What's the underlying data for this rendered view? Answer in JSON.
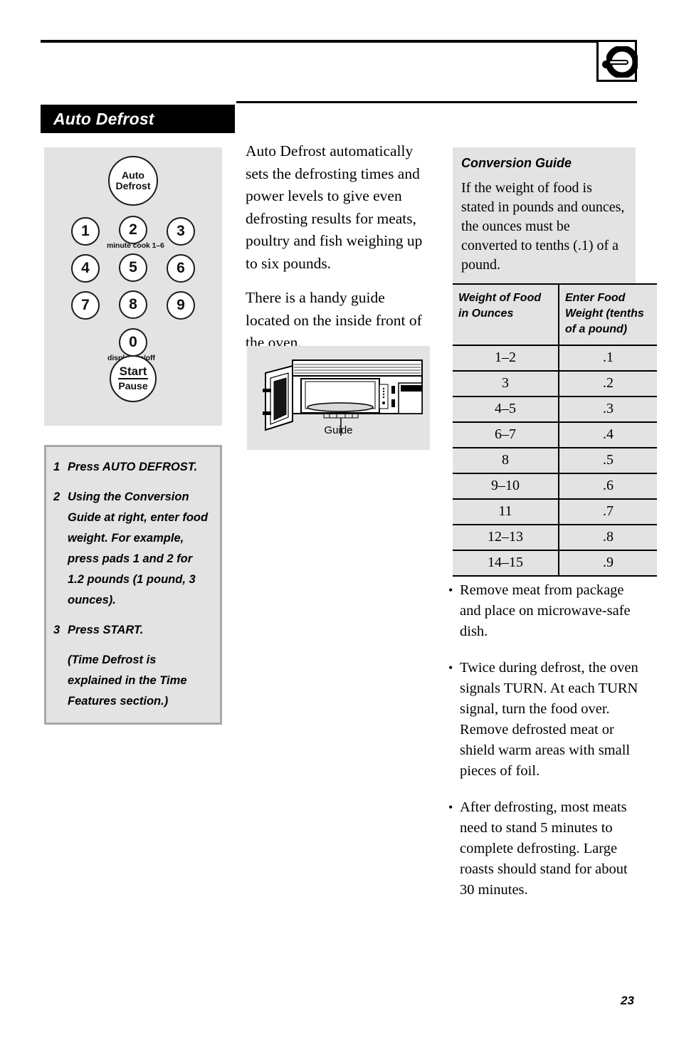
{
  "page": {
    "number": "23",
    "section_title": "Auto Defrost",
    "tab_icon": "control-knob-icon"
  },
  "keypad": {
    "auto_defrost_pad": {
      "line1": "Auto",
      "line2": "Defrost"
    },
    "number_pads": [
      "1",
      "2",
      "3",
      "4",
      "5",
      "6",
      "7",
      "8",
      "9"
    ],
    "zero_pad": "0",
    "captions": {
      "minute_cook": "minute cook 1–6",
      "display_onoff": "display on/off"
    },
    "start_pad": {
      "line1": "Start",
      "line2": "Pause"
    }
  },
  "steps": [
    {
      "num": "1",
      "text": "Press AUTO DEFROST."
    },
    {
      "num": "2",
      "text": "Using the Conversion Guide at right, enter food weight. For example, press pads 1 and 2 for 1.2 pounds (1 pound, 3 ounces)."
    },
    {
      "num": "3",
      "text": "Press START."
    }
  ],
  "steps_note": "(Time Defrost is explained in the Time Features section.)",
  "intro": {
    "paragraph1": "Auto Defrost automatically sets the defrosting times and power levels to give even defrosting results for meats, poultry and fish weighing up to six pounds.",
    "paragraph2": "There is a handy guide located on the inside front of the oven."
  },
  "figure": {
    "caption": "Guide",
    "name": "microwave-oven-with-open-door"
  },
  "conversion_guide": {
    "title": "Conversion Guide",
    "description": "If the weight of food is stated in pounds and ounces, the ounces must be converted to tenths (.1) of a pound.",
    "columns": [
      "Weight of Food in Ounces",
      "Enter Food Weight (tenths of a pound)"
    ],
    "rows": [
      {
        "ounces": "1–2",
        "pounds": ".1"
      },
      {
        "ounces": "3",
        "pounds": ".2"
      },
      {
        "ounces": "4–5",
        "pounds": ".3"
      },
      {
        "ounces": "6–7",
        "pounds": ".4"
      },
      {
        "ounces": "8",
        "pounds": ".5"
      },
      {
        "ounces": "9–10",
        "pounds": ".6"
      },
      {
        "ounces": "11",
        "pounds": ".7"
      },
      {
        "ounces": "12–13",
        "pounds": ".8"
      },
      {
        "ounces": "14–15",
        "pounds": ".9"
      }
    ]
  },
  "tips": [
    "Remove meat from package and place on microwave-safe dish.",
    "Twice during defrost, the oven signals TURN. At each TURN signal, turn the food over. Remove defrosted meat or shield warm areas with small pieces of foil.",
    "After defrosting, most meats need to stand 5 minutes to complete defrosting. Large roasts should stand for about 30 minutes."
  ],
  "colors": {
    "panel_gray": "#e3e3e3",
    "box_border_gray": "#a8a8a8",
    "ink": "#000000"
  }
}
